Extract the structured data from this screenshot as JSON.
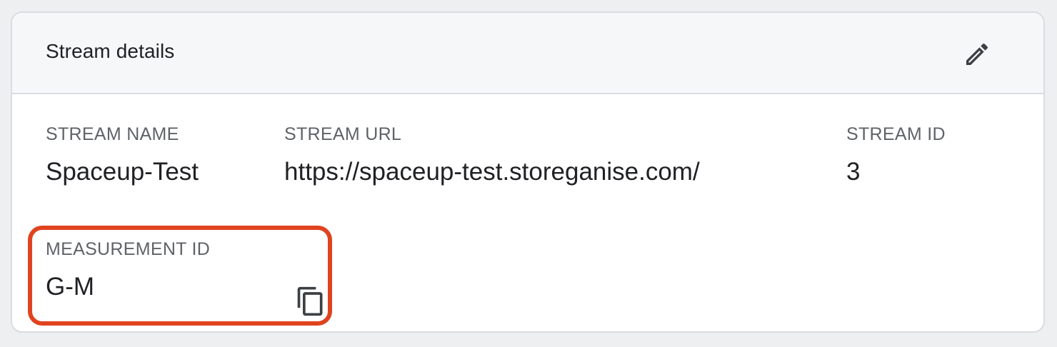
{
  "card": {
    "title": "Stream details",
    "edit_icon": "pencil-icon"
  },
  "fields": {
    "stream_name": {
      "label": "STREAM NAME",
      "value": "Spaceup-Test"
    },
    "stream_url": {
      "label": "STREAM URL",
      "value": "https://spaceup-test.storeganise.com/"
    },
    "stream_id": {
      "label": "STREAM ID",
      "value": "3"
    },
    "measurement_id": {
      "label": "MEASUREMENT ID",
      "value": "G-M",
      "copy_icon": "copy-icon"
    }
  },
  "colors": {
    "highlight": "#e0431f",
    "background": "#eeeff0",
    "header_bg": "#f6f7f9",
    "border": "#dadce0",
    "label": "#5f6368",
    "text": "#202124"
  }
}
